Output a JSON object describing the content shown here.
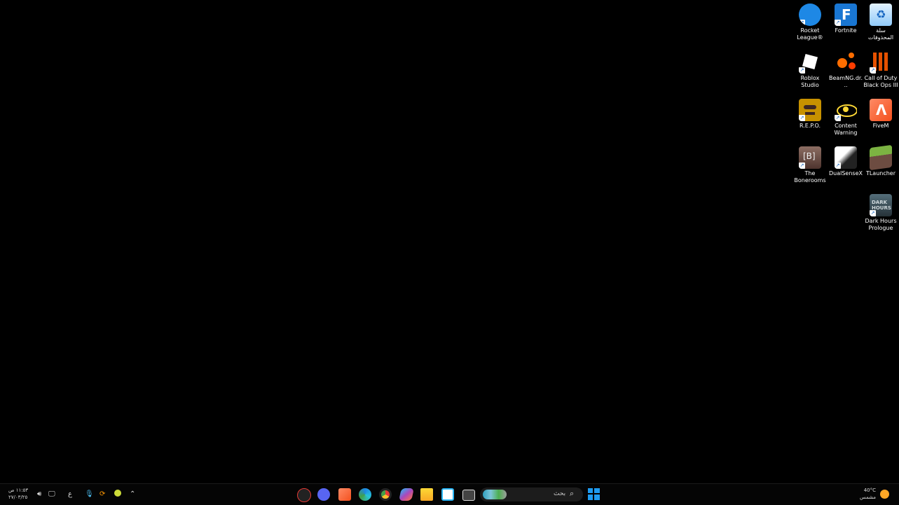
{
  "desktop": {
    "icons": [
      {
        "id": "rocket-league",
        "label": "Rocket League®",
        "icon": "rocket-league-icon",
        "color": "#1e88e5"
      },
      {
        "id": "fortnite",
        "label": "Fortnite",
        "icon": "fortnite-icon",
        "color": "#1976d2"
      },
      {
        "id": "recycle-bin",
        "label": "سلة المحذوفات",
        "icon": "recycle-bin-icon",
        "color": "#90caf9"
      },
      {
        "id": "roblox-studio",
        "label": "Roblox Studio",
        "icon": "roblox-studio-icon",
        "color": "#ffffff"
      },
      {
        "id": "beamng",
        "label": "BeamNG.dr...",
        "icon": "beamng-icon",
        "color": "#ff6d00"
      },
      {
        "id": "cod-bo3",
        "label": "Call of Duty Black Ops III",
        "icon": "call-of-duty-icon",
        "color": "#e65100"
      },
      {
        "id": "repo",
        "label": "R.E.P.O.",
        "icon": "repo-icon",
        "color": "#c79100"
      },
      {
        "id": "content-warning",
        "label": "Content Warning",
        "icon": "content-warning-icon",
        "color": "#fdd835"
      },
      {
        "id": "fivem",
        "label": "FiveM",
        "icon": "fivem-icon",
        "color": "#ff7043"
      },
      {
        "id": "bonerooms",
        "label": "The Bonerooms",
        "icon": "bonerooms-icon",
        "color": "#6d4c41"
      },
      {
        "id": "dualsensex",
        "label": "DualSenseX",
        "icon": "dualsensex-icon",
        "color": "#eeeeee"
      },
      {
        "id": "tlauncher",
        "label": "TLauncher",
        "icon": "tlauncher-icon",
        "color": "#558b2f"
      },
      {
        "id": "dark-hours",
        "label": "Dark Hours Prologue",
        "icon": "dark-hours-icon",
        "color": "#37474f"
      }
    ]
  },
  "taskbar": {
    "clock": {
      "time": "١١:٥٣ ص",
      "date": "٢٧/٠٣/٢٥"
    },
    "language": "ع",
    "search": {
      "placeholder": "بحث"
    },
    "weather": {
      "temp": "40°C",
      "condition": "مشمس"
    },
    "apps": [
      {
        "id": "app-1",
        "icon": "clock-app-icon",
        "color": "#e53935"
      },
      {
        "id": "discord",
        "icon": "discord-icon",
        "color": "#5865f2"
      },
      {
        "id": "fivem-task",
        "icon": "fivem-icon",
        "color": "#ff7043"
      },
      {
        "id": "edge",
        "icon": "edge-icon",
        "color": "#1e88e5"
      },
      {
        "id": "chrome",
        "icon": "chrome-icon",
        "color": "#43a047"
      },
      {
        "id": "copilot",
        "icon": "copilot-icon",
        "color": "#8e24aa"
      },
      {
        "id": "file-explorer",
        "icon": "folder-icon",
        "color": "#fbc02d"
      },
      {
        "id": "store",
        "icon": "store-icon",
        "color": "#29b6f6"
      },
      {
        "id": "task-view",
        "icon": "task-view-icon",
        "color": "#dddddd"
      }
    ]
  }
}
